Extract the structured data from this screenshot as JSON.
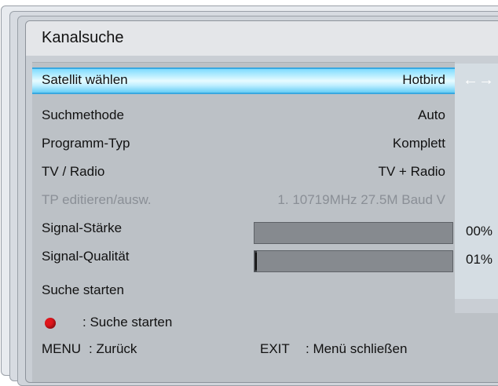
{
  "window": {
    "title": "Kanalsuche"
  },
  "rows": [
    {
      "label": "Satellit wählen",
      "value": "Hotbird",
      "selected": true
    },
    {
      "label": "Suchmethode",
      "value": "Auto"
    },
    {
      "label": "Programm-Typ",
      "value": "Komplett"
    },
    {
      "label": "TV / Radio",
      "value": "TV + Radio"
    },
    {
      "label": "TP editieren/ausw.",
      "value": "1. 10719MHz 27.5M Baud V",
      "disabled": true
    }
  ],
  "selector_arrows": "←→",
  "signal": {
    "strength_label": "Signal-Stärke",
    "strength_value": "00%",
    "strength_fraction": 0.0,
    "quality_label": "Signal-Qualität",
    "quality_value": "01%",
    "quality_fraction": 0.01
  },
  "start_search": {
    "label": "Suche starten"
  },
  "footer": {
    "red_hint": ": Suche starten",
    "menu_key": "MENU",
    "menu_hint": ": Zurück",
    "exit_key": "EXIT",
    "exit_hint": ": Menü schließen"
  },
  "colors": {
    "highlight": "#aeeaff",
    "red_button": "#e0161c",
    "bar": "#868a8f"
  }
}
